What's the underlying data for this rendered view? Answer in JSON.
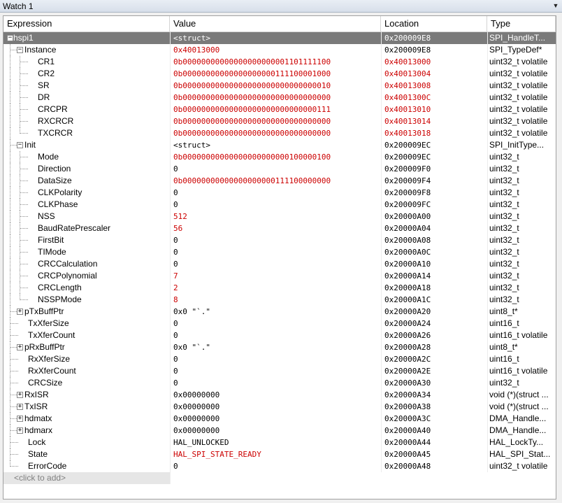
{
  "window": {
    "title": "Watch 1",
    "dropdown_icon": "chevron-down-icon"
  },
  "columns": [
    "Expression",
    "Value",
    "Location",
    "Type"
  ],
  "add_prompt": "<click to add>",
  "rows": [
    {
      "name": "hspi1",
      "depth": 0,
      "exp": "minus",
      "value": "<struct>",
      "loc": "0x200009E8",
      "type": "SPI_HandleT...",
      "red": false,
      "sel": true
    },
    {
      "name": "Instance",
      "depth": 1,
      "exp": "minus",
      "value": "0x40013000",
      "loc": "0x200009E8",
      "type": "SPI_TypeDef*",
      "red": true
    },
    {
      "name": "CR1",
      "depth": 2,
      "value": "0b00000000000000000000001101111100",
      "loc": "0x40013000",
      "type": "uint32_t volatile",
      "red": true,
      "redloc": true
    },
    {
      "name": "CR2",
      "depth": 2,
      "value": "0b00000000000000000000111100001000",
      "loc": "0x40013004",
      "type": "uint32_t volatile",
      "red": true,
      "redloc": true
    },
    {
      "name": "SR",
      "depth": 2,
      "value": "0b00000000000000000000000000000010",
      "loc": "0x40013008",
      "type": "uint32_t volatile",
      "red": true,
      "redloc": true
    },
    {
      "name": "DR",
      "depth": 2,
      "value": "0b00000000000000000000000000000000",
      "loc": "0x4001300C",
      "type": "uint32_t volatile",
      "red": true,
      "redloc": true
    },
    {
      "name": "CRCPR",
      "depth": 2,
      "value": "0b00000000000000000000000000000111",
      "loc": "0x40013010",
      "type": "uint32_t volatile",
      "red": true,
      "redloc": true
    },
    {
      "name": "RXCRCR",
      "depth": 2,
      "value": "0b00000000000000000000000000000000",
      "loc": "0x40013014",
      "type": "uint32_t volatile",
      "red": true,
      "redloc": true
    },
    {
      "name": "TXCRCR",
      "depth": 2,
      "value": "0b00000000000000000000000000000000",
      "loc": "0x40013018",
      "type": "uint32_t volatile",
      "red": true,
      "redloc": true
    },
    {
      "name": "Init",
      "depth": 1,
      "exp": "minus",
      "value": "<struct>",
      "loc": "0x200009EC",
      "type": "SPI_InitType...",
      "red": false
    },
    {
      "name": "Mode",
      "depth": 2,
      "value": "0b00000000000000000000000100000100",
      "loc": "0x200009EC",
      "type": "uint32_t",
      "red": true
    },
    {
      "name": "Direction",
      "depth": 2,
      "value": "0",
      "loc": "0x200009F0",
      "type": "uint32_t",
      "red": false
    },
    {
      "name": "DataSize",
      "depth": 2,
      "value": "0b00000000000000000000111100000000",
      "loc": "0x200009F4",
      "type": "uint32_t",
      "red": true
    },
    {
      "name": "CLKPolarity",
      "depth": 2,
      "value": "0",
      "loc": "0x200009F8",
      "type": "uint32_t",
      "red": false
    },
    {
      "name": "CLKPhase",
      "depth": 2,
      "value": "0",
      "loc": "0x200009FC",
      "type": "uint32_t",
      "red": false
    },
    {
      "name": "NSS",
      "depth": 2,
      "value": "512",
      "loc": "0x20000A00",
      "type": "uint32_t",
      "red": true
    },
    {
      "name": "BaudRatePrescaler",
      "depth": 2,
      "value": "56",
      "loc": "0x20000A04",
      "type": "uint32_t",
      "red": true
    },
    {
      "name": "FirstBit",
      "depth": 2,
      "value": "0",
      "loc": "0x20000A08",
      "type": "uint32_t",
      "red": false
    },
    {
      "name": "TIMode",
      "depth": 2,
      "value": "0",
      "loc": "0x20000A0C",
      "type": "uint32_t",
      "red": false
    },
    {
      "name": "CRCCalculation",
      "depth": 2,
      "value": "0",
      "loc": "0x20000A10",
      "type": "uint32_t",
      "red": false
    },
    {
      "name": "CRCPolynomial",
      "depth": 2,
      "value": "7",
      "loc": "0x20000A14",
      "type": "uint32_t",
      "red": true
    },
    {
      "name": "CRCLength",
      "depth": 2,
      "value": "2",
      "loc": "0x20000A18",
      "type": "uint32_t",
      "red": true
    },
    {
      "name": "NSSPMode",
      "depth": 2,
      "value": "8",
      "loc": "0x20000A1C",
      "type": "uint32_t",
      "red": true
    },
    {
      "name": "pTxBuffPtr",
      "depth": 1,
      "exp": "plus",
      "value": "0x0 \"`.\"",
      "loc": "0x20000A20",
      "type": "uint8_t*",
      "red": false
    },
    {
      "name": "TxXferSize",
      "depth": 1,
      "value": "0",
      "loc": "0x20000A24",
      "type": "uint16_t",
      "red": false
    },
    {
      "name": "TxXferCount",
      "depth": 1,
      "value": "0",
      "loc": "0x20000A26",
      "type": "uint16_t volatile",
      "red": false
    },
    {
      "name": "pRxBuffPtr",
      "depth": 1,
      "exp": "plus",
      "value": "0x0 \"`.\"",
      "loc": "0x20000A28",
      "type": "uint8_t*",
      "red": false
    },
    {
      "name": "RxXferSize",
      "depth": 1,
      "value": "0",
      "loc": "0x20000A2C",
      "type": "uint16_t",
      "red": false
    },
    {
      "name": "RxXferCount",
      "depth": 1,
      "value": "0",
      "loc": "0x20000A2E",
      "type": "uint16_t volatile",
      "red": false
    },
    {
      "name": "CRCSize",
      "depth": 1,
      "value": "0",
      "loc": "0x20000A30",
      "type": "uint32_t",
      "red": false
    },
    {
      "name": "RxISR",
      "depth": 1,
      "exp": "plus",
      "value": "0x00000000",
      "loc": "0x20000A34",
      "type": "void (*)(struct ...",
      "red": false
    },
    {
      "name": "TxISR",
      "depth": 1,
      "exp": "plus",
      "value": "0x00000000",
      "loc": "0x20000A38",
      "type": "void (*)(struct ...",
      "red": false
    },
    {
      "name": "hdmatx",
      "depth": 1,
      "exp": "plus",
      "value": "0x00000000",
      "loc": "0x20000A3C",
      "type": "DMA_Handle...",
      "red": false
    },
    {
      "name": "hdmarx",
      "depth": 1,
      "exp": "plus",
      "value": "0x00000000",
      "loc": "0x20000A40",
      "type": "DMA_Handle...",
      "red": false
    },
    {
      "name": "Lock",
      "depth": 1,
      "value": "HAL_UNLOCKED",
      "loc": "0x20000A44",
      "type": "HAL_LockTy...",
      "red": false
    },
    {
      "name": "State",
      "depth": 1,
      "value": "HAL_SPI_STATE_READY",
      "loc": "0x20000A45",
      "type": "HAL_SPI_Stat...",
      "red": true
    },
    {
      "name": "ErrorCode",
      "depth": 1,
      "value": "0",
      "loc": "0x20000A48",
      "type": "uint32_t volatile",
      "red": false
    }
  ]
}
